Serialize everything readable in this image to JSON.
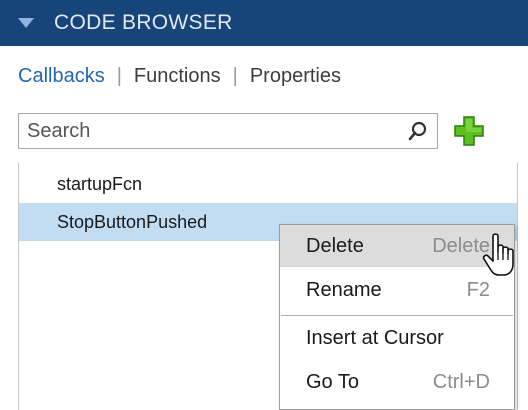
{
  "header": {
    "title": "CODE BROWSER"
  },
  "tabs": [
    {
      "label": "Callbacks",
      "active": true
    },
    {
      "label": "Functions",
      "active": false
    },
    {
      "label": "Properties",
      "active": false
    }
  ],
  "search": {
    "placeholder": "Search",
    "value": ""
  },
  "list": {
    "items": [
      {
        "label": "startupFcn",
        "selected": false
      },
      {
        "label": "StopButtonPushed",
        "selected": true
      }
    ]
  },
  "context_menu": {
    "items": [
      {
        "label": "Delete",
        "shortcut": "Delete",
        "hovered": true
      },
      {
        "label": "Rename",
        "shortcut": "F2",
        "hovered": false
      },
      {
        "label": "Insert at Cursor",
        "shortcut": "",
        "hovered": false
      },
      {
        "label": "Go To",
        "shortcut": "Ctrl+D",
        "hovered": false
      }
    ]
  },
  "colors": {
    "header_bg": "#17457a",
    "active_tab": "#2267b3",
    "selection": "#c2dcf2",
    "add_icon": "#5cc01f"
  },
  "icons": [
    "collapse-triangle-icon",
    "search-icon",
    "add-plus-icon",
    "hand-pointer-icon"
  ]
}
